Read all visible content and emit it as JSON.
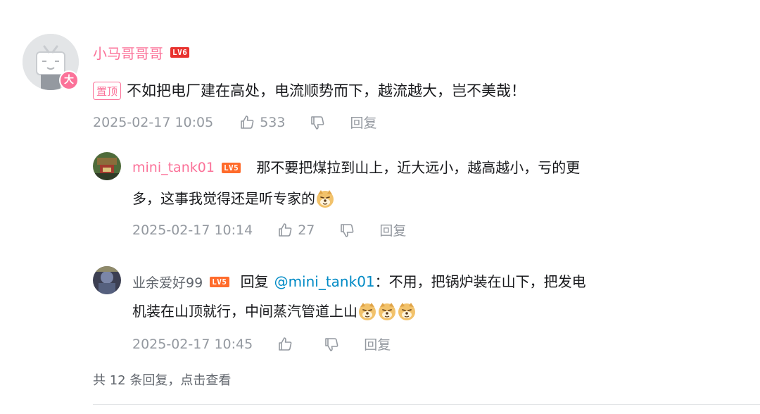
{
  "main_comment": {
    "username": "小马哥哥哥",
    "level": "LV6",
    "user_badge": "大",
    "pin_tag": "置顶",
    "text": "不如把电厂建在高处，电流顺势而下，越流越大，岂不美哉！",
    "time": "2025-02-17 10:05",
    "likes": "533",
    "reply_label": "回复"
  },
  "replies": [
    {
      "username": "mini_tank01",
      "level": "LV5",
      "line1": "那不要把煤拉到山上，近大远小，越高越小，亏的更",
      "line2": "多，这事我觉得还是听专家的",
      "time": "2025-02-17 10:14",
      "likes": "27",
      "reply_label": "回复"
    },
    {
      "username": "业余爱好99",
      "level": "LV5",
      "reply_prefix": "回复",
      "mention": "@mini_tank01",
      "line1": "：不用，把锅炉装在山下，把发电",
      "line2": "机装在山顶就行，中间蒸汽管道上山",
      "time": "2025-02-17 10:45",
      "likes": "",
      "reply_label": "回复"
    }
  ],
  "more_replies": "共 12 条回复，点击查看",
  "icons": [
    "like-icon",
    "dislike-icon",
    "doge-emoji-icon",
    "tv-avatar-icon"
  ],
  "colors": {
    "brand_pink": "#fb7299",
    "meta_gray": "#9499a0",
    "link_blue": "#008ac5",
    "level_orange": "#ff6b2b"
  }
}
